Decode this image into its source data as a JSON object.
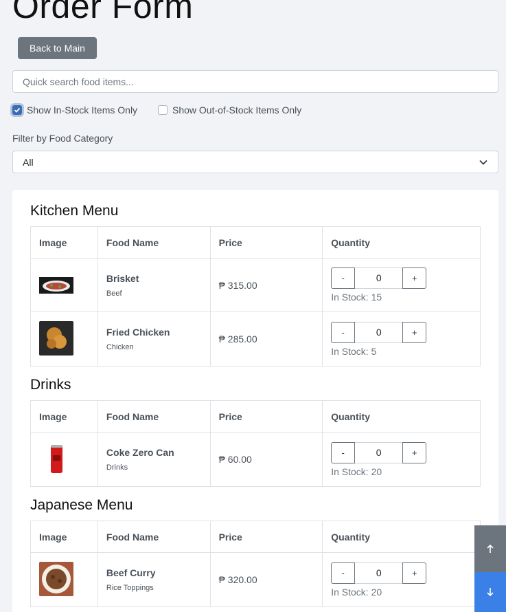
{
  "header": {
    "title": "Order Form",
    "back_label": "Back to Main"
  },
  "search": {
    "placeholder": "Quick search food items...",
    "value": ""
  },
  "filters": {
    "in_stock_label": "Show In-Stock Items Only",
    "in_stock_checked": true,
    "out_stock_label": "Show Out-of-Stock Items Only",
    "out_stock_checked": false,
    "category_label": "Filter by Food Category",
    "category_value": "All"
  },
  "table_headers": {
    "image": "Image",
    "name": "Food Name",
    "price": "Price",
    "quantity": "Quantity"
  },
  "sections": [
    {
      "title": "Kitchen Menu",
      "items": [
        {
          "name": "Brisket",
          "category": "Beef",
          "price": "₱ 315.00",
          "qty": "0",
          "stock": "In Stock: 15",
          "image_icon": "brisket-photo"
        },
        {
          "name": "Fried Chicken",
          "category": "Chicken",
          "price": "₱ 285.00",
          "qty": "0",
          "stock": "In Stock: 5",
          "image_icon": "fried-chicken-photo"
        }
      ]
    },
    {
      "title": "Drinks",
      "items": [
        {
          "name": "Coke Zero Can",
          "category": "Drinks",
          "price": "₱ 60.00",
          "qty": "0",
          "stock": "In Stock: 20",
          "image_icon": "coke-can-photo"
        }
      ]
    },
    {
      "title": "Japanese Menu",
      "items": [
        {
          "name": "Beef Curry",
          "category": "Rice Toppings",
          "price": "₱ 320.00",
          "qty": "0",
          "stock": "In Stock: 20",
          "image_icon": "beef-curry-photo"
        }
      ]
    }
  ],
  "qty_controls": {
    "minus": "-",
    "plus": "+"
  },
  "colors": {
    "primary": "#3b80e6",
    "secondary": "#6c757d"
  }
}
